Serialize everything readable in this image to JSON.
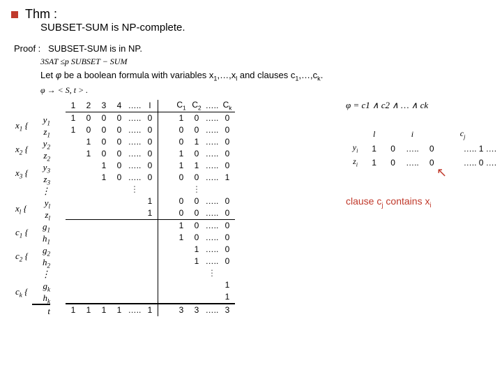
{
  "header": {
    "thm": "Thm :",
    "statement": "SUBSET-SUM  is NP-complete.",
    "proof_lead": "Proof :",
    "proof_text": "SUBSET-SUM  is in NP.",
    "sat_line": "3SAT ≤p SUBSET − SUM",
    "let_pre": "Let ",
    "let_phi": "φ",
    "let_mid": " be a boolean formula with variables x",
    "let_rest": "1,…,xl and clauses c1,…,ck.",
    "phi_map": "φ → < S, t > ."
  },
  "table": {
    "cols": [
      "1",
      "2",
      "3",
      "4",
      "…..",
      "l",
      "",
      "C1",
      "C2",
      "…..",
      "Ck"
    ],
    "row_labels": [
      "y1",
      "z1",
      "y2",
      "z2",
      "y3",
      "z3",
      "⋮",
      "yl",
      "zl",
      "g1",
      "h1",
      "g2",
      "h2",
      "⋮",
      "gk",
      "hk",
      "t"
    ],
    "var_pair_labels": [
      "x1",
      "x2",
      "x3",
      "xl"
    ],
    "clause_pair_labels": [
      "c1",
      "c2",
      "ck"
    ],
    "sections": {
      "block1": [
        [
          "1",
          "0",
          "0",
          "0",
          "…..",
          "0",
          "",
          "1",
          "0",
          "…..",
          "0"
        ],
        [
          "1",
          "0",
          "0",
          "0",
          "…..",
          "0",
          "",
          "0",
          "0",
          "…..",
          "0"
        ],
        [
          "",
          "1",
          "0",
          "0",
          "…..",
          "0",
          "",
          "0",
          "1",
          "…..",
          "0"
        ],
        [
          "",
          "1",
          "0",
          "0",
          "…..",
          "0",
          "",
          "1",
          "0",
          "…..",
          "0"
        ],
        [
          "",
          "",
          "1",
          "0",
          "…..",
          "0",
          "",
          "1",
          "1",
          "…..",
          "0"
        ],
        [
          "",
          "",
          "1",
          "0",
          "…..",
          "0",
          "",
          "0",
          "0",
          "…..",
          "1"
        ]
      ],
      "vdots1": [
        "",
        "",
        "",
        "",
        "⋮",
        "",
        "",
        "",
        "⋮",
        "",
        ""
      ],
      "block2": [
        [
          "",
          "",
          "",
          "",
          "",
          "1",
          "",
          "0",
          "0",
          "…..",
          "0"
        ],
        [
          "",
          "",
          "",
          "",
          "",
          "1",
          "",
          "0",
          "0",
          "…..",
          "0"
        ]
      ],
      "block3": [
        [
          "",
          "",
          "",
          "",
          "",
          "",
          "",
          "1",
          "0",
          "…..",
          "0"
        ],
        [
          "",
          "",
          "",
          "",
          "",
          "",
          "",
          "1",
          "0",
          "…..",
          "0"
        ],
        [
          "",
          "",
          "",
          "",
          "",
          "",
          "",
          "",
          "1",
          "…..",
          "0"
        ],
        [
          "",
          "",
          "",
          "",
          "",
          "",
          "",
          "",
          "1",
          "…..",
          "0"
        ]
      ],
      "vdots2": [
        "",
        "",
        "",
        "",
        "",
        "",
        "",
        "",
        "",
        "⋮",
        ""
      ],
      "block4": [
        [
          "",
          "",
          "",
          "",
          "",
          "",
          "",
          "",
          "",
          "",
          "1"
        ],
        [
          "",
          "",
          "",
          "",
          "",
          "",
          "",
          "",
          "",
          "",
          "1"
        ]
      ],
      "trow": [
        "1",
        "1",
        "1",
        "1",
        "…..",
        "1",
        "",
        "3",
        "3",
        "…..",
        "3"
      ]
    }
  },
  "right": {
    "phi_expand": "φ = c1 ∧ c2 ∧ … ∧ ck",
    "mini_hdr": [
      "",
      "l",
      "",
      "i",
      "",
      "",
      "cj",
      ""
    ],
    "mini_rows": [
      [
        "yi",
        "1",
        "0",
        "…..",
        "0",
        "",
        "….. 1 …."
      ],
      [
        "zi",
        "1",
        "0",
        "…..",
        "0",
        "",
        "….. 0 …."
      ]
    ],
    "clause_note": "clause cj contains xi"
  }
}
